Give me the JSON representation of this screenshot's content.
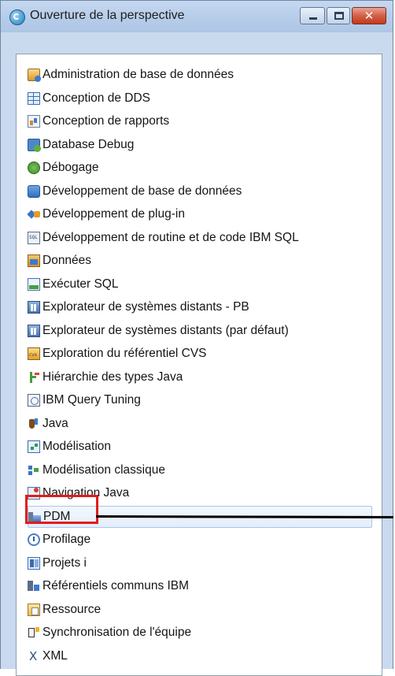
{
  "window": {
    "title": "Ouverture de la perspective",
    "buttons": {
      "minimize_glyph": "",
      "maximize_glyph": "",
      "close_glyph": "✕"
    }
  },
  "perspectives": [
    {
      "label": "Administration de base de données",
      "icon": "database-admin-icon"
    },
    {
      "label": "Conception de DDS",
      "icon": "dds-grid-icon"
    },
    {
      "label": "Conception de rapports",
      "icon": "report-design-icon"
    },
    {
      "label": "Database Debug",
      "icon": "database-debug-icon"
    },
    {
      "label": "Débogage",
      "icon": "bug-icon"
    },
    {
      "label": "Développement de base de données",
      "icon": "database-dev-icon"
    },
    {
      "label": "Développement de plug-in",
      "icon": "plugin-icon"
    },
    {
      "label": "Développement de routine et de code IBM SQL",
      "icon": "sql-icon"
    },
    {
      "label": "Données",
      "icon": "data-icon"
    },
    {
      "label": "Exécuter SQL",
      "icon": "run-sql-icon"
    },
    {
      "label": "Explorateur de systèmes distants - PB",
      "icon": "remote-systems-icon"
    },
    {
      "label": "Explorateur de systèmes distants (par défaut)",
      "icon": "remote-systems-icon"
    },
    {
      "label": "Exploration du référentiel CVS",
      "icon": "cvs-icon"
    },
    {
      "label": "Hiérarchie des types Java",
      "icon": "type-hierarchy-icon"
    },
    {
      "label": "IBM Query Tuning",
      "icon": "query-tuning-icon"
    },
    {
      "label": "Java",
      "icon": "java-icon"
    },
    {
      "label": "Modélisation",
      "icon": "modeling-icon"
    },
    {
      "label": "Modélisation classique",
      "icon": "classic-modeling-icon"
    },
    {
      "label": "Navigation Java",
      "icon": "java-browsing-icon"
    },
    {
      "label": "PDM",
      "icon": "pdm-icon",
      "selected": true
    },
    {
      "label": "Profilage",
      "icon": "profiling-icon"
    },
    {
      "label": "Projets i",
      "icon": "projects-i-icon"
    },
    {
      "label": "Référentiels communs IBM",
      "icon": "shared-repositories-icon"
    },
    {
      "label": "Ressource",
      "icon": "resource-icon"
    },
    {
      "label": "Synchronisation de l'équipe",
      "icon": "team-sync-icon"
    },
    {
      "label": "XML",
      "icon": "xml-icon"
    }
  ],
  "colors": {
    "annotation_box": "#e31c1c",
    "annotation_line": "#000000",
    "selection": "#e3eefb"
  }
}
